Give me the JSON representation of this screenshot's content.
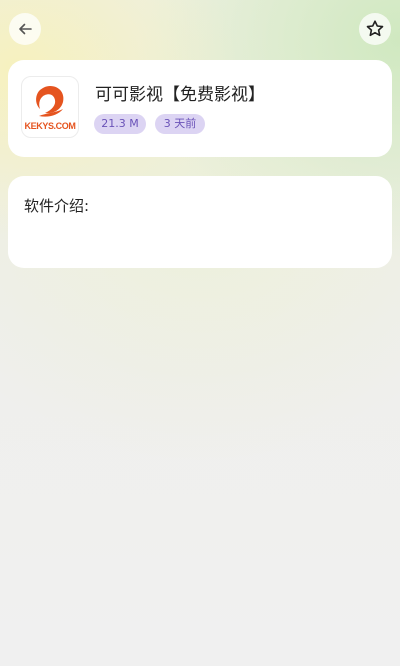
{
  "header": {
    "back_icon": "arrow-left-icon",
    "favorite_icon": "star-outline-icon"
  },
  "app": {
    "icon_name": "kekys-logo",
    "logo_text": "KEKYS.COM",
    "title": "可可影视【免费影视】",
    "size": "21.3 M",
    "updated": "3 天前",
    "accent_color": "#e5541f",
    "tag_color": "#6a52b8"
  },
  "intro": {
    "label": "软件介绍:"
  }
}
